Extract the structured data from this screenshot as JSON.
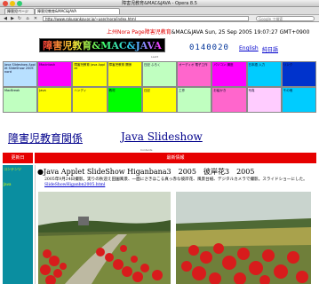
{
  "window": {
    "title": "障害児教育&MAC&JAVA - Opera 8.5"
  },
  "tabs": [
    {
      "label": "障害児ページ"
    },
    {
      "label": "障害児教育&MAC&JAVA"
    }
  ],
  "address": {
    "url": "http://www.rokusankay.or.jp/~user/nora/index.html",
    "search_placeholder": "Google で検索"
  },
  "header": {
    "marquee_red": "上州Nora Page障害児教育",
    "marquee_black": "&MAC&JAVA Sun, 25 Sep 2005 19:07:27 GMT+0900",
    "logo": "障害児教育&MAC&JAVA",
    "counter": "0140020",
    "english": "English",
    "japanese": "純日語"
  },
  "nav": {
    "row_label_1": "Last3",
    "row_label_2": "Last3",
    "cells": [
      {
        "color": "#b8e0ff",
        "text": "Java Slideshow Applet SlideShow 2005 nord"
      },
      {
        "color": "#ff00ff",
        "text": "Macintosh"
      },
      {
        "color": "#ffff00",
        "text": "障害児教育 Java Applet"
      },
      {
        "color": "#ffff00",
        "text": "障害児教育 関係"
      },
      {
        "color": "#c0ffc0",
        "text": "日記 ふろく"
      },
      {
        "color": "#ff66cc",
        "text": "オーディオ 電子工作"
      },
      {
        "color": "#ff00ff",
        "text": "パソコン 講座"
      },
      {
        "color": "#00ccff",
        "text": "日本語 入力"
      },
      {
        "color": "#0033cc",
        "text": "リンク"
      },
      {
        "color": "#c0ffc0",
        "text": "MacBreak"
      },
      {
        "color": "#ffff00",
        "text": "Java"
      },
      {
        "color": "#ffff00",
        "text": "ハンディ"
      },
      {
        "color": "#00ff00",
        "text": "教材"
      },
      {
        "color": "#ffff00",
        "text": "日記"
      },
      {
        "color": "#c0ffc0",
        "text": "工作"
      },
      {
        "color": "#ff66cc",
        "text": "お絵かき"
      },
      {
        "color": "#ffccff",
        "text": "写真"
      },
      {
        "color": "#00ccff",
        "text": "その他"
      }
    ]
  },
  "sections": {
    "left_title": "障害児教育関係",
    "right_title": "Java Slideshow",
    "small_label": "Contents"
  },
  "table": {
    "head_left": "更新日",
    "head_right": "最新情報",
    "side_lines": [
      "コンテンツ",
      "Java"
    ]
  },
  "article": {
    "title": "●Java Applet SlideShow Higanbana3　2005　彼岸花3　2005",
    "desc": "2005年9月24日撮影。実りの秋迎え田園風景、一面にさきほこる真っ赤な彼岸花、風景台紙、デジタルカメラで撮影。スライドショーにした。",
    "link": "SlideShowHiganbn2005.html"
  },
  "colors": {
    "accent_red": "#e60000",
    "side_teal": "#0a8ea0",
    "link_blue": "#0000cc"
  }
}
